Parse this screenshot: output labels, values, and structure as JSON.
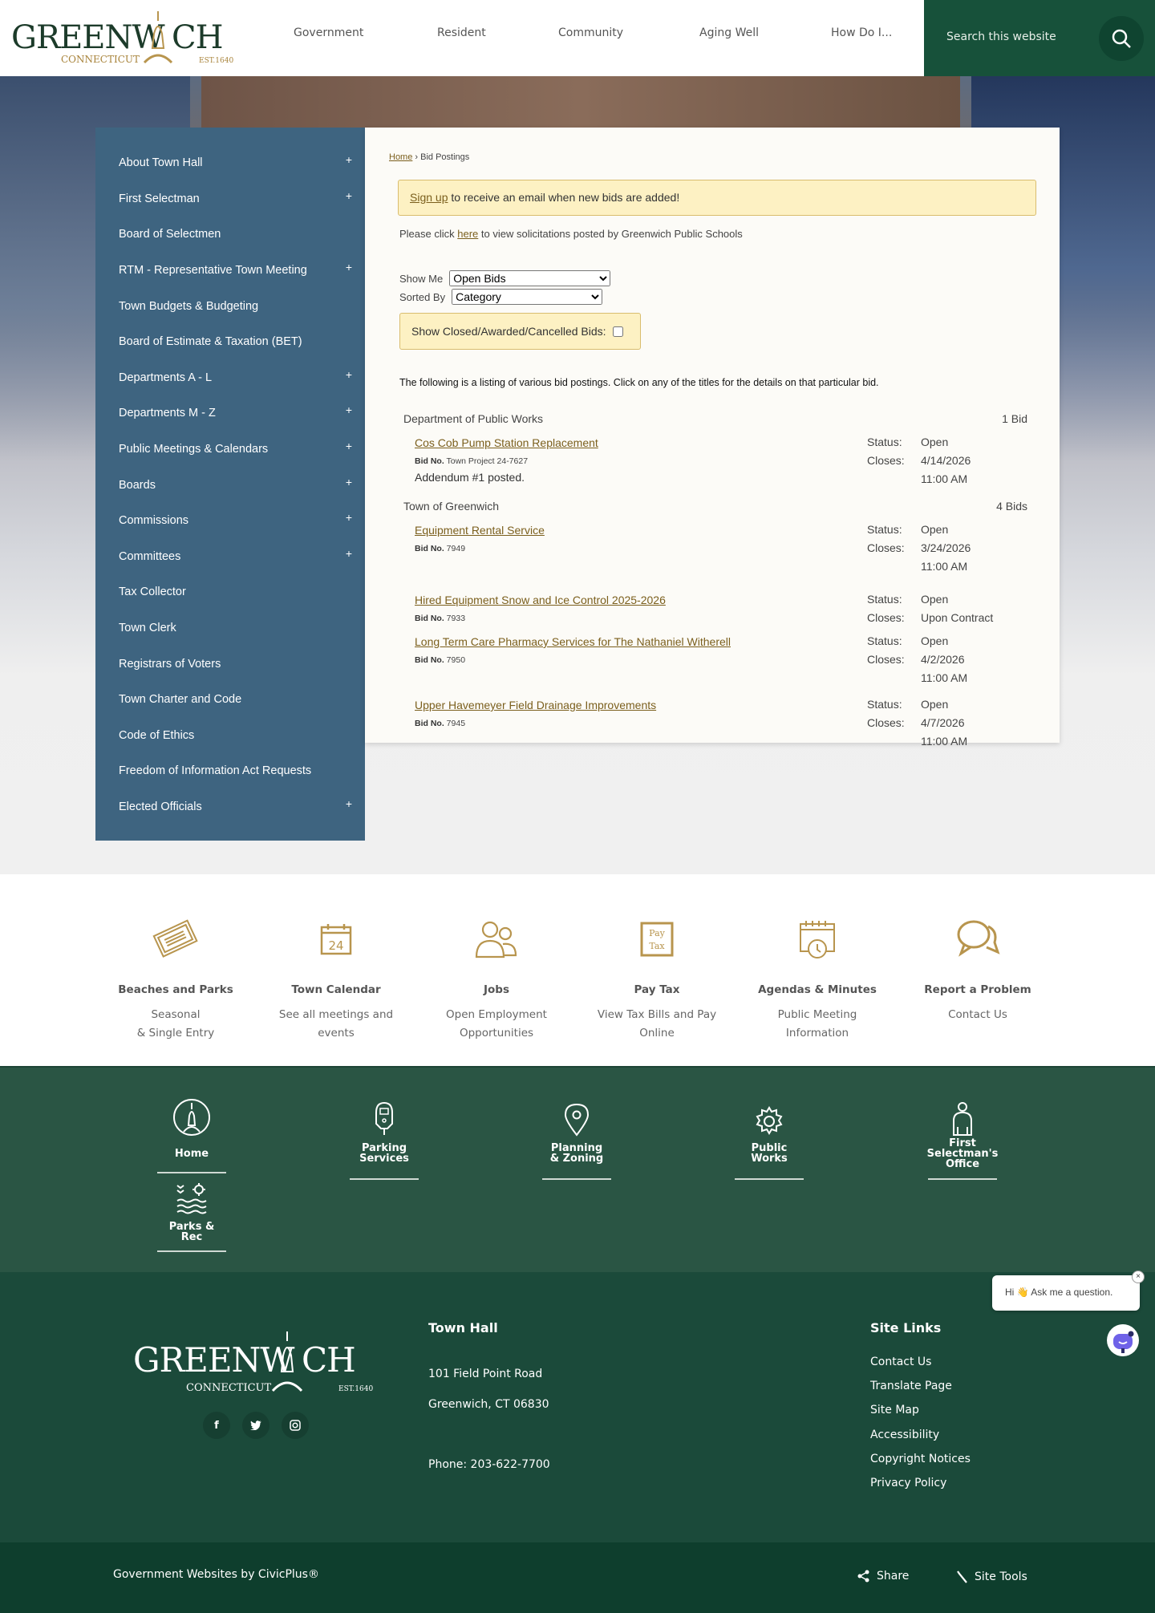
{
  "header": {
    "logo_text": "GREENWICH",
    "logo_sub": "CONNECTICUT",
    "logo_est": "EST. 1640",
    "nav": [
      "Government",
      "Resident",
      "Community",
      "Aging Well",
      "How Do I..."
    ],
    "search_placeholder": "Search this website"
  },
  "sidebar": {
    "items": [
      {
        "label": "About Town Hall",
        "plus": "+"
      },
      {
        "label": "First Selectman",
        "plus": "+"
      },
      {
        "label": "Board of Selectmen",
        "plus": ""
      },
      {
        "label": "RTM - Representative Town Meeting",
        "plus": "+"
      },
      {
        "label": "Town Budgets & Budgeting",
        "plus": ""
      },
      {
        "label": "Board of Estimate & Taxation (BET)",
        "plus": ""
      },
      {
        "label": "Departments A - L",
        "plus": "+"
      },
      {
        "label": "Departments M - Z",
        "plus": "+"
      },
      {
        "label": "Public Meetings & Calendars",
        "plus": "+"
      },
      {
        "label": "Boards",
        "plus": "+"
      },
      {
        "label": "Commissions",
        "plus": "+"
      },
      {
        "label": "Committees",
        "plus": "+"
      },
      {
        "label": "Tax Collector",
        "plus": ""
      },
      {
        "label": "Town Clerk",
        "plus": ""
      },
      {
        "label": "Registrars of Voters",
        "plus": ""
      },
      {
        "label": "Town Charter and Code",
        "plus": ""
      },
      {
        "label": "Code of Ethics",
        "plus": ""
      },
      {
        "label": "Freedom of Information Act Requests",
        "plus": ""
      },
      {
        "label": "Elected Officials",
        "plus": "+"
      }
    ]
  },
  "content": {
    "breadcrumb": {
      "home": "Home",
      "sep": "›",
      "current": "Bid Postings"
    },
    "signup": {
      "link": "Sign up",
      "text": " to receive an email when new bids are added!"
    },
    "schools": {
      "pre": "Please click ",
      "link": "here",
      "post": " to view solicitations posted by Greenwich Public Schools"
    },
    "show_me": {
      "label": "Show Me",
      "value": "Open Bids"
    },
    "sorted_by": {
      "label": "Sorted By",
      "value": "Category"
    },
    "closed_label": "Show Closed/Awarded/Cancelled Bids:",
    "listing_text": "The following is a listing of various bid postings. Click on any of the titles for the details on that particular bid.",
    "status_label": "Status:",
    "closes_label": "Closes:",
    "bidno_label": "Bid No.",
    "categories": [
      {
        "name": "Department of Public Works",
        "count": "1 Bid",
        "bids": [
          {
            "title": "Cos Cob Pump Station Replacement",
            "bid_no": "Town Project 24-7627",
            "extra": "Addendum #1 posted.",
            "status": "Open",
            "closes": "4/14/2026 11:00 AM"
          }
        ]
      },
      {
        "name": "Town of Greenwich",
        "count": "4 Bids",
        "bids": [
          {
            "title": "Equipment Rental Service",
            "bid_no": "7949",
            "extra": "",
            "status": "Open",
            "closes": "3/24/2026 11:00 AM"
          },
          {
            "title": "Hired Equipment Snow and Ice Control 2025-2026",
            "bid_no": "7933",
            "extra": "",
            "status": "Open",
            "closes": "Upon Contract"
          },
          {
            "title": "Long Term Care Pharmacy Services for The Nathaniel Witherell",
            "bid_no": "7950",
            "extra": "",
            "status": "Open",
            "closes": "4/2/2026 11:00 AM"
          },
          {
            "title": "Upper Havemeyer Field Drainage Improvements",
            "bid_no": "7945",
            "extra": "",
            "status": "Open",
            "closes": "4/7/2026 11:00 AM"
          }
        ]
      }
    ]
  },
  "quick_links": [
    {
      "title": "Beaches and Parks",
      "desc": "Seasonal\n& Single Entry",
      "icon": "tickets-icon"
    },
    {
      "title": "Town Calendar",
      "desc": "See all meetings and events",
      "icon": "calendar-icon",
      "cal_day": "24"
    },
    {
      "title": "Jobs",
      "desc": "Open Employment Opportunities",
      "icon": "people-icon"
    },
    {
      "title": "Pay Tax",
      "desc": "View Tax Bills and Pay Online",
      "icon": "pay-tax-icon",
      "icon_text1": "Pay",
      "icon_text2": "Tax"
    },
    {
      "title": "Agendas & Minutes",
      "desc": "Public Meeting Information",
      "icon": "calendar-clock-icon"
    },
    {
      "title": "Report a Problem",
      "desc": "Contact Us",
      "icon": "chat-bubbles-icon"
    }
  ],
  "green_nav": [
    {
      "label": "Home",
      "icon": "town-hall-icon"
    },
    {
      "label": "Parking Services",
      "icon": "parking-meter-icon"
    },
    {
      "label": "Planning & Zoning",
      "icon": "map-pin-icon"
    },
    {
      "label": "Public Works",
      "icon": "gear-icon"
    },
    {
      "label": "First Selectman's Office",
      "icon": "person-icon"
    },
    {
      "label": "Parks & Rec",
      "icon": "sun-waves-icon"
    }
  ],
  "footer": {
    "town_hall": {
      "heading": "Town Hall",
      "address1": "101 Field Point Road",
      "address2": "Greenwich, CT 06830",
      "phone": "Phone:  203-622-7700"
    },
    "site_links": {
      "heading": "Site Links",
      "items": [
        "Contact Us",
        "Translate Page",
        "Site Map",
        "Accessibility",
        "Copyright Notices",
        "Privacy Policy"
      ]
    },
    "social": [
      "f",
      "t",
      "ig"
    ]
  },
  "bottom": {
    "credit": "Government Websites by CivicPlus®",
    "share": "Share",
    "site_tools": "Site Tools"
  },
  "chat": {
    "text": "Hi 👋 Ask me a question.",
    "close": "×"
  },
  "colors": {
    "sidebar": "#3e6480",
    "brand_green": "#17513a",
    "gold": "#b8954e",
    "link": "#7b5f1d"
  }
}
